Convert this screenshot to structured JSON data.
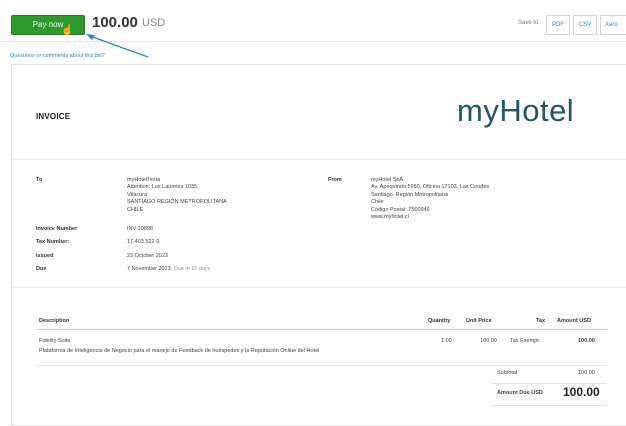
{
  "toolbar": {
    "pay_label": "Pay now",
    "amount": "100.00",
    "currency": "USD",
    "save_to": "Save to",
    "pdf": "PDF",
    "csv": "CSV",
    "xero": "Xero",
    "questions": "Questions or comments about this bill?"
  },
  "invoice": {
    "title": "INVOICE",
    "logo": "myHotel",
    "to_label": "To",
    "to_lines": [
      "myHotelTesta",
      "Attention: Los Laureles 1035",
      "Vitacura",
      "SANTIAGO REGIÓN METROPOLITANA",
      "CHILE"
    ],
    "from_label": "From",
    "from_lines": [
      "myHotel SpA",
      "Av. Apoquindo 5950, Oficina 17103, Las Condes",
      "Santiago, Región Metropolitana",
      "Chile",
      "Código Postal: 7560949",
      "www.myhotel.cl"
    ],
    "number_label": "Invoice Number",
    "number": "INV-20898",
    "tax_label": "Tax Number:",
    "tax": "17.403.522-9",
    "issued_label": "Issued",
    "issued": "23 October 2023",
    "due_label": "Due",
    "due": "7 November 2023,",
    "due_note": "Due in 15 days"
  },
  "table": {
    "headers": [
      "Description",
      "Quantity",
      "Unit Price",
      "Tax",
      "Amount USD"
    ],
    "row": {
      "name": "Fidelity Suite",
      "description": "Plataforma de Inteligencia de Negocio para el manejo de Feedback de huéspedes y la Reputación Online del Hotel",
      "quantity": "1.00",
      "unit_price": "100.00",
      "tax": "Tax Exempt",
      "amount": "100.00"
    },
    "subtotal_label": "Subtotal",
    "subtotal": "100.00",
    "amount_due_label": "Amount Due USD",
    "amount_due": "100.00"
  },
  "colors": {
    "pay_button": "#2e9a2e",
    "link": "#3a7cc4",
    "logo": "#23556e"
  }
}
